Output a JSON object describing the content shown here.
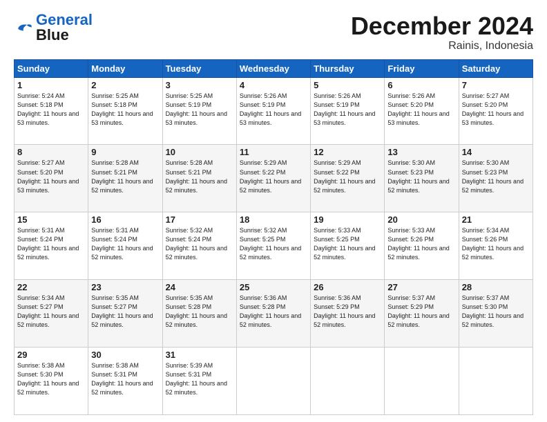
{
  "header": {
    "logo_line1": "General",
    "logo_line2": "Blue",
    "month": "December 2024",
    "location": "Rainis, Indonesia"
  },
  "weekdays": [
    "Sunday",
    "Monday",
    "Tuesday",
    "Wednesday",
    "Thursday",
    "Friday",
    "Saturday"
  ],
  "weeks": [
    [
      {
        "day": 1,
        "sunrise": "5:24 AM",
        "sunset": "5:18 PM",
        "daylight": "11 hours and 53 minutes."
      },
      {
        "day": 2,
        "sunrise": "5:25 AM",
        "sunset": "5:18 PM",
        "daylight": "11 hours and 53 minutes."
      },
      {
        "day": 3,
        "sunrise": "5:25 AM",
        "sunset": "5:19 PM",
        "daylight": "11 hours and 53 minutes."
      },
      {
        "day": 4,
        "sunrise": "5:26 AM",
        "sunset": "5:19 PM",
        "daylight": "11 hours and 53 minutes."
      },
      {
        "day": 5,
        "sunrise": "5:26 AM",
        "sunset": "5:19 PM",
        "daylight": "11 hours and 53 minutes."
      },
      {
        "day": 6,
        "sunrise": "5:26 AM",
        "sunset": "5:20 PM",
        "daylight": "11 hours and 53 minutes."
      },
      {
        "day": 7,
        "sunrise": "5:27 AM",
        "sunset": "5:20 PM",
        "daylight": "11 hours and 53 minutes."
      }
    ],
    [
      {
        "day": 8,
        "sunrise": "5:27 AM",
        "sunset": "5:20 PM",
        "daylight": "11 hours and 53 minutes."
      },
      {
        "day": 9,
        "sunrise": "5:28 AM",
        "sunset": "5:21 PM",
        "daylight": "11 hours and 52 minutes."
      },
      {
        "day": 10,
        "sunrise": "5:28 AM",
        "sunset": "5:21 PM",
        "daylight": "11 hours and 52 minutes."
      },
      {
        "day": 11,
        "sunrise": "5:29 AM",
        "sunset": "5:22 PM",
        "daylight": "11 hours and 52 minutes."
      },
      {
        "day": 12,
        "sunrise": "5:29 AM",
        "sunset": "5:22 PM",
        "daylight": "11 hours and 52 minutes."
      },
      {
        "day": 13,
        "sunrise": "5:30 AM",
        "sunset": "5:23 PM",
        "daylight": "11 hours and 52 minutes."
      },
      {
        "day": 14,
        "sunrise": "5:30 AM",
        "sunset": "5:23 PM",
        "daylight": "11 hours and 52 minutes."
      }
    ],
    [
      {
        "day": 15,
        "sunrise": "5:31 AM",
        "sunset": "5:24 PM",
        "daylight": "11 hours and 52 minutes."
      },
      {
        "day": 16,
        "sunrise": "5:31 AM",
        "sunset": "5:24 PM",
        "daylight": "11 hours and 52 minutes."
      },
      {
        "day": 17,
        "sunrise": "5:32 AM",
        "sunset": "5:24 PM",
        "daylight": "11 hours and 52 minutes."
      },
      {
        "day": 18,
        "sunrise": "5:32 AM",
        "sunset": "5:25 PM",
        "daylight": "11 hours and 52 minutes."
      },
      {
        "day": 19,
        "sunrise": "5:33 AM",
        "sunset": "5:25 PM",
        "daylight": "11 hours and 52 minutes."
      },
      {
        "day": 20,
        "sunrise": "5:33 AM",
        "sunset": "5:26 PM",
        "daylight": "11 hours and 52 minutes."
      },
      {
        "day": 21,
        "sunrise": "5:34 AM",
        "sunset": "5:26 PM",
        "daylight": "11 hours and 52 minutes."
      }
    ],
    [
      {
        "day": 22,
        "sunrise": "5:34 AM",
        "sunset": "5:27 PM",
        "daylight": "11 hours and 52 minutes."
      },
      {
        "day": 23,
        "sunrise": "5:35 AM",
        "sunset": "5:27 PM",
        "daylight": "11 hours and 52 minutes."
      },
      {
        "day": 24,
        "sunrise": "5:35 AM",
        "sunset": "5:28 PM",
        "daylight": "11 hours and 52 minutes."
      },
      {
        "day": 25,
        "sunrise": "5:36 AM",
        "sunset": "5:28 PM",
        "daylight": "11 hours and 52 minutes."
      },
      {
        "day": 26,
        "sunrise": "5:36 AM",
        "sunset": "5:29 PM",
        "daylight": "11 hours and 52 minutes."
      },
      {
        "day": 27,
        "sunrise": "5:37 AM",
        "sunset": "5:29 PM",
        "daylight": "11 hours and 52 minutes."
      },
      {
        "day": 28,
        "sunrise": "5:37 AM",
        "sunset": "5:30 PM",
        "daylight": "11 hours and 52 minutes."
      }
    ],
    [
      {
        "day": 29,
        "sunrise": "5:38 AM",
        "sunset": "5:30 PM",
        "daylight": "11 hours and 52 minutes."
      },
      {
        "day": 30,
        "sunrise": "5:38 AM",
        "sunset": "5:31 PM",
        "daylight": "11 hours and 52 minutes."
      },
      {
        "day": 31,
        "sunrise": "5:39 AM",
        "sunset": "5:31 PM",
        "daylight": "11 hours and 52 minutes."
      },
      null,
      null,
      null,
      null
    ]
  ]
}
